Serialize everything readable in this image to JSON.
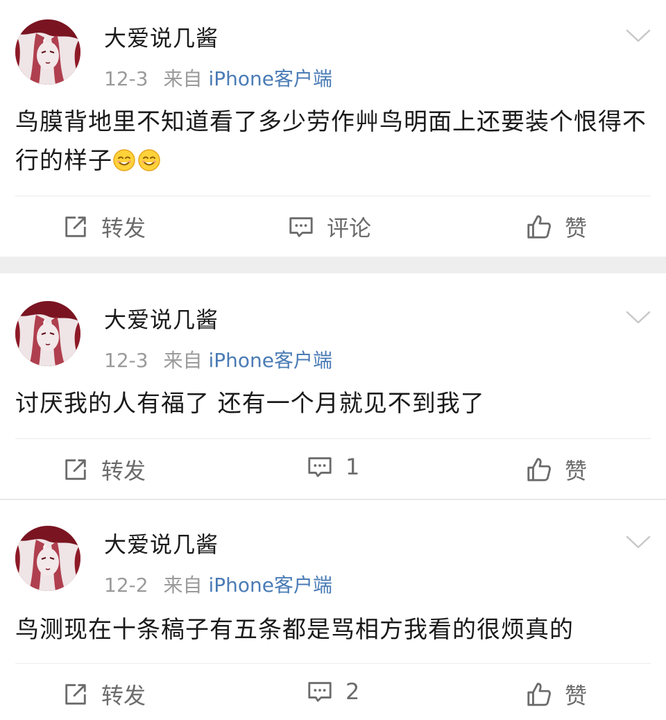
{
  "posts": [
    {
      "username": "大爱说几酱",
      "date": "12-3",
      "from_label": "来自",
      "source": "iPhone客户端",
      "text": "鸟膜背地里不知道看了多少劳作艸鸟明面上还要装个恨得不行的样子",
      "emojis": [
        "smile-emoji",
        "smile-emoji"
      ],
      "actions": {
        "repost": "转发",
        "comment": "评论",
        "like": "赞"
      }
    },
    {
      "username": "大爱说几酱",
      "date": "12-3",
      "from_label": "来自",
      "source": "iPhone客户端",
      "text": "讨厌我的人有福了 还有一个月就见不到我了",
      "actions": {
        "repost": "转发",
        "comment": "1",
        "like": "赞"
      }
    },
    {
      "username": "大爱说几酱",
      "date": "12-2",
      "from_label": "来自",
      "source": "iPhone客户端",
      "text": "鸟测现在十条稿子有五条都是骂相方我看的很烦真的",
      "actions": {
        "repost": "转发",
        "comment": "2",
        "like": "赞"
      }
    }
  ],
  "colors": {
    "source_link": "#4a7bb5",
    "meta_gray": "#9a9a9a",
    "action_gray": "#6b6b6b",
    "section_gap": "#eeeeee"
  }
}
